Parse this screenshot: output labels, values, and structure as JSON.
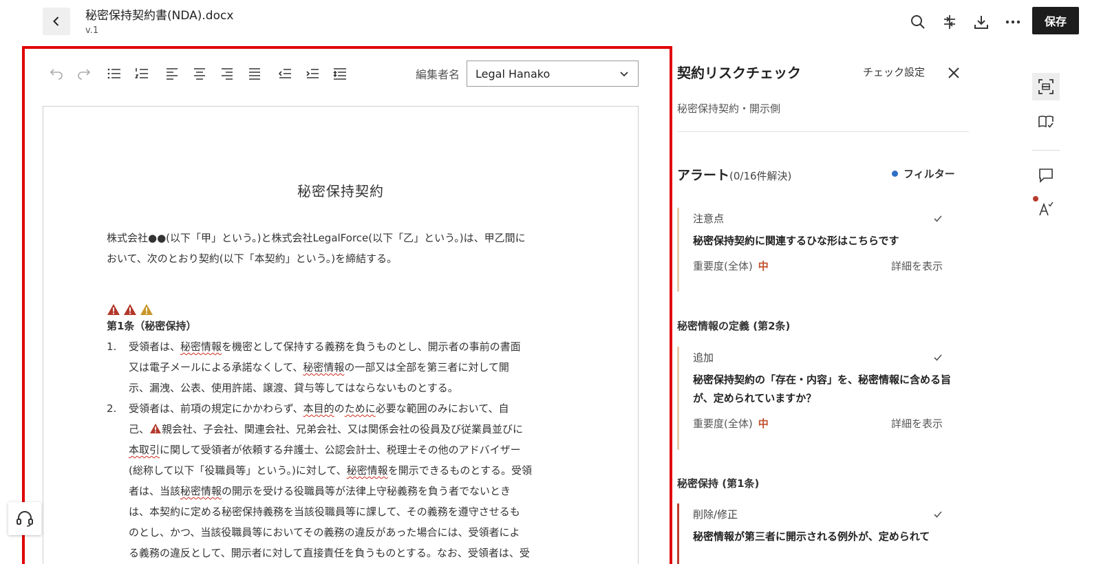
{
  "header": {
    "doc_title": "秘密保持契約書(NDA).docx",
    "version": "v.1",
    "save_label": "保存",
    "icons": [
      "search-icon",
      "compare-icon",
      "download-icon",
      "more-icon"
    ]
  },
  "toolbar": {
    "editor_label": "編集者名",
    "editor_value": "Legal Hanako",
    "buttons": [
      "undo-icon",
      "redo-icon",
      "bullet-list-icon",
      "numbered-list-icon",
      "align-left-icon",
      "align-center-icon",
      "align-right-icon",
      "align-justify-icon",
      "outdent-icon",
      "indent-icon",
      "line-spacing-icon"
    ]
  },
  "document": {
    "title": "秘密保持契約",
    "intro_1": "株式会社●●(以下「甲」という。)と株式会社LegalForce(以下「乙」という。)は、甲乙間に",
    "intro_2": "おいて、次のとおり契約(以下「本契約」という。)を締結する。",
    "article_1_heading": "第1条（秘密保持）",
    "clause_1_num": "1.",
    "clause_1_l1a": "受領者は、",
    "clause_1_l1b": "秘密情報",
    "clause_1_l1c": "を機密として保持する義務を負うものとし、開示者の事前の書面",
    "clause_1_l2a": "又は電子メールによる承諾なくして、",
    "clause_1_l2b": "秘密情報",
    "clause_1_l2c": "の一部又は全部を第三者に対して開",
    "clause_1_l3": "示、漏洩、公表、使用許諾、譲渡、貸与等してはならないものとする。",
    "clause_2_num": "2.",
    "clause_2_l1a": "受領者は、前項の規定にかかわらず、",
    "clause_2_l1b": "本目的",
    "clause_2_l1c": "の",
    "clause_2_l1d": "ために",
    "clause_2_l1e": "必要な範囲のみにおいて、自",
    "clause_2_l2a": "己、",
    "clause_2_l2b": "親会社、子会社、関連会社、兄弟会社、又は関係会社の役員及び従業員並びに",
    "clause_2_l3a": "本取引",
    "clause_2_l3b": "に関して受領者が依頼する弁護士、公認会計士、税理士その他のアドバイザー",
    "clause_2_l4a": "(総称して以下「役職員等」という。)に対して、",
    "clause_2_l4b": "秘密情報",
    "clause_2_l4c": "を開示できるものとする。受領",
    "clause_2_l5a": "者は、当該",
    "clause_2_l5b": "秘密情報",
    "clause_2_l5c": "の開示を受ける役職員等が法律上守秘義務を負う者でないとき",
    "clause_2_l6": "は、本契約に定める秘密保持義務を当該役職員等に課して、その義務を遵守させるも",
    "clause_2_l7": "のとし、かつ、当該役職員等においてその義務の違反があった場合には、受領者によ",
    "clause_2_l8": "る義務の違反として、開示者に対して直接責任を負うものとする。なお、受領者は、受"
  },
  "panel": {
    "title": "契約リスクチェック",
    "settings_label": "チェック設定",
    "subtitle": "秘密保持契約・開示側",
    "alert_heading": "アラート",
    "alert_count": "(0/16件解決)",
    "filter_label": "フィルター",
    "severity_label": "重要度(全体)",
    "detail_label": "詳細を表示",
    "cards": [
      {
        "tag": "注意点",
        "message": "秘密保持契約に関連するひな形はこちらです",
        "severity": "中"
      },
      {
        "section": "秘密情報の定義 (第2条)",
        "tag": "追加",
        "message": "秘密保持契約の「存在・内容」を、秘密情報に含める旨が、定められていますか？",
        "severity": "中"
      },
      {
        "section": "秘密保持 (第1条)",
        "tag": "削除/修正",
        "message": "秘密情報が第三者に開示される例外が、定められて"
      }
    ]
  },
  "rail": {
    "icons": [
      "scan-icon",
      "book-check-icon",
      "comment-icon",
      "spellcheck-icon"
    ]
  },
  "colors": {
    "highlight_frame": "#e00000",
    "warning_dark": "#b3392b",
    "warning_amber": "#c9962a",
    "severity_medium": "#c0502b",
    "filter_dot": "#2f6fc4"
  }
}
